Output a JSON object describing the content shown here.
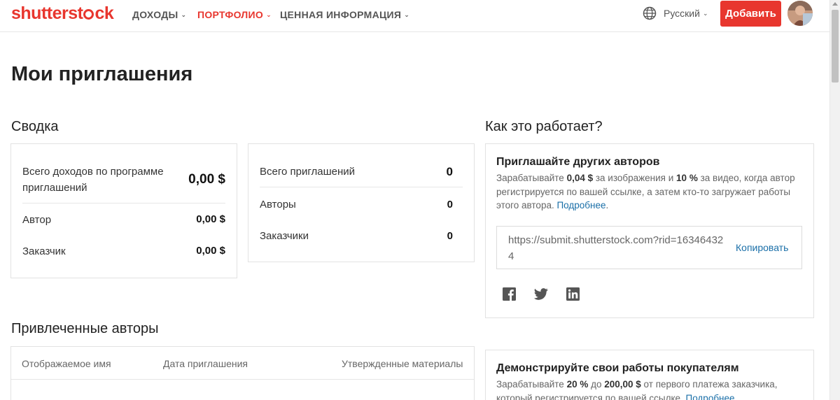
{
  "header": {
    "logo": {
      "left": "shutterst",
      "right": "ck"
    },
    "nav": [
      {
        "label": "ДОХОДЫ"
      },
      {
        "label": "ПОРТФОЛИО"
      },
      {
        "label": "ЦЕННАЯ ИНФОРМАЦИЯ"
      }
    ],
    "language": "Русский",
    "add_button": "Добавить"
  },
  "page_title": "Мои приглашения",
  "summary": {
    "title": "Сводка",
    "earnings": {
      "total_label": "Всего доходов по программе приглашений",
      "total_value": "0,00 $",
      "author_label": "Автор",
      "author_value": "0,00 $",
      "customer_label": "Заказчик",
      "customer_value": "0,00 $"
    },
    "invites": {
      "total_label": "Всего приглашений",
      "total_value": "0",
      "authors_label": "Авторы",
      "authors_value": "0",
      "customers_label": "Заказчики",
      "customers_value": "0"
    }
  },
  "how_it_works": {
    "title": "Как это работает?",
    "invite_card": {
      "heading": "Приглашайте других авторов",
      "text_1": "Зарабатывайте ",
      "bold_1": "0,04 $",
      "text_2": " за изображения и ",
      "bold_2": "10 %",
      "text_3": " за видео, когда автор регистрируется по вашей ссылке, а затем кто-то загружает работы этого автора. ",
      "more_link": "Подробнее",
      "end": ".",
      "url": "https://submit.shutterstock.com?rid=163464324",
      "copy_label": "Копировать"
    },
    "showcase_card": {
      "heading": "Демонстрируйте свои работы покупателям",
      "text_1": "Зарабатывайте ",
      "bold_1": "20 %",
      "text_2": " до ",
      "bold_2": "200,00 $",
      "text_3": " от первого платежа заказчика, который регистрируется по вашей ссылке. ",
      "more_link": "Подробнее",
      "end": "."
    },
    "social_icons": [
      "facebook-icon",
      "twitter-icon",
      "linkedin-icon"
    ]
  },
  "referred_authors": {
    "title": "Привлеченные авторы",
    "columns": [
      "Отображаемое имя",
      "Дата приглашения",
      "Утвержденные материалы"
    ]
  },
  "colors": {
    "brand": "#e8362e",
    "link": "#1a6fa8"
  }
}
